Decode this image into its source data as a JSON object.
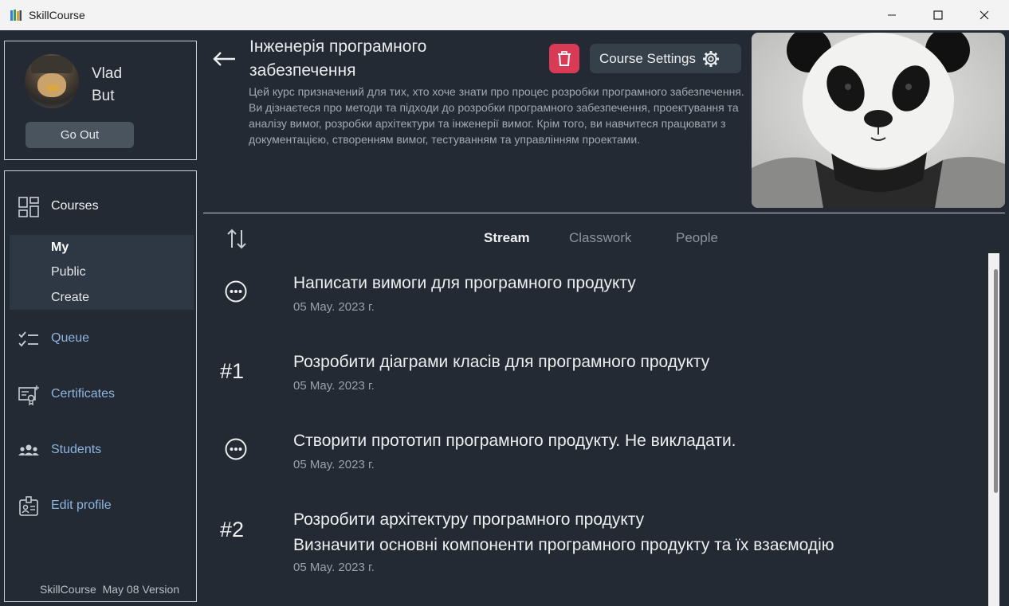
{
  "window": {
    "title": "SkillCourse",
    "controls": [
      "minimize-icon",
      "maximize-icon",
      "close-icon"
    ]
  },
  "profile": {
    "first_name": "Vlad",
    "last_name": "But",
    "go_out_label": "Go Out"
  },
  "sidebar": {
    "courses_label": "Courses",
    "sub_items": [
      "My",
      "Public",
      "Create"
    ],
    "active_sub": "My",
    "queue_label": "Queue",
    "certificates_label": "Certificates",
    "students_label": "Students",
    "edit_profile_label": "Edit profile",
    "version_text": "SkillCourse  May 08 Version"
  },
  "course": {
    "title": "Інженерія програмного забезпечення",
    "description": "Цей курс призначений для тих, хто хоче знати про процес розробки програмного забезпечення. Ви дізнаєтеся про методи та підходи до розробки програмного забезпечення, проектування та аналізу вимог, розробки архітектури та інженерії вимог. Крім того, ви навчитеся працювати з документацією, створенням вимог, тестуванням та управлінням проектами.",
    "settings_label": "Course Settings"
  },
  "tabs": {
    "stream": "Stream",
    "classwork": "Classwork",
    "people": "People",
    "active": "Stream"
  },
  "feed": [
    {
      "marker": "dots",
      "title": "Написати вимоги для програмного продукту",
      "subtitle": "",
      "date": "05 May. 2023 г."
    },
    {
      "marker": "#1",
      "title": "Розробити діаграми класів для програмного продукту",
      "subtitle": "",
      "date": "05 May. 2023 г."
    },
    {
      "marker": "dots",
      "title": "Створити прототип програмного продукту. Не викладати.",
      "subtitle": "",
      "date": "05 May. 2023 г."
    },
    {
      "marker": "#2",
      "title": "Розробити архітектуру програмного продукту",
      "subtitle": "Визначити основні компоненти програмного продукту та їх взаємодію",
      "date": "05 May. 2023 г."
    }
  ],
  "colors": {
    "background": "#232a33",
    "delete": "#d93a55",
    "link": "#8eb4e0"
  }
}
